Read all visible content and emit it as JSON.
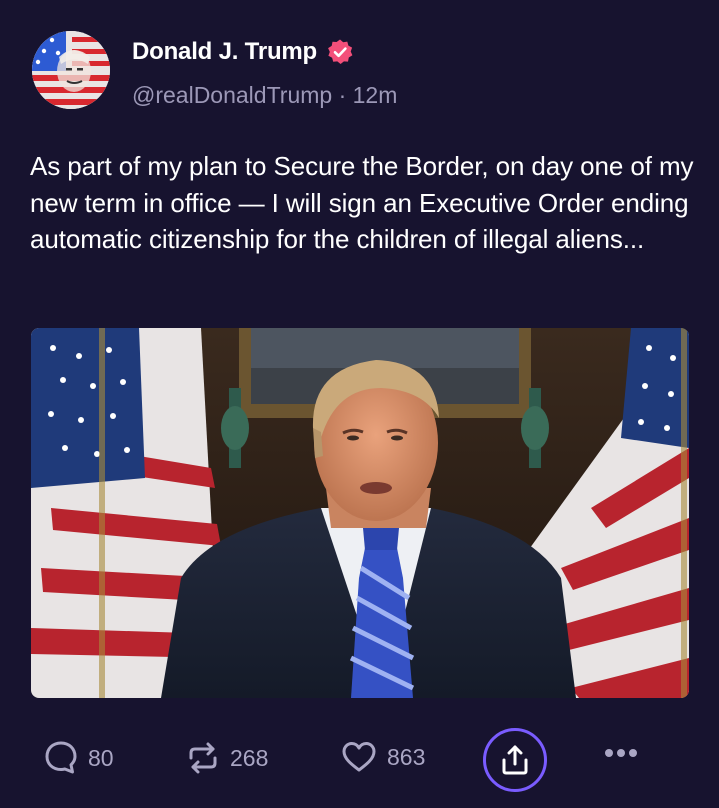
{
  "author": {
    "display_name": "Donald J. Trump",
    "handle": "@realDonaldTrump",
    "separator": "·",
    "time_ago": "12m",
    "verified": true,
    "verified_color": "#f34f7a"
  },
  "post": {
    "text": "As part of my plan to Secure the Border, on day one of my new term in office — I will sign an Executive Order ending automatic citizenship for the children of illegal aliens..."
  },
  "media": {
    "type": "video-thumbnail"
  },
  "actions": {
    "reply_count": "80",
    "repost_count": "268",
    "like_count": "863",
    "reply_icon": "reply-bubble-icon",
    "repost_icon": "repost-arrows-icon",
    "like_icon": "heart-icon",
    "share_icon": "share-upload-icon",
    "more_icon": "more-dots-icon"
  },
  "theme": {
    "background": "#17132f",
    "muted_text": "#9c98b7",
    "accent": "#7a5cff"
  }
}
